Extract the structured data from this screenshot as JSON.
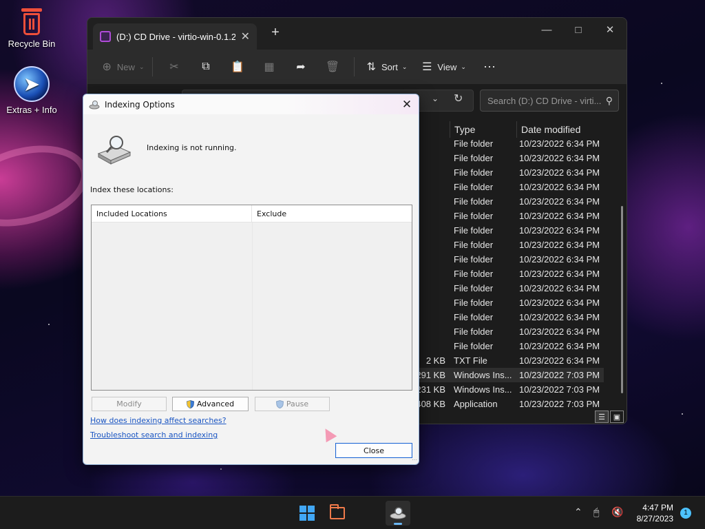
{
  "desktop": {
    "icons": [
      {
        "label": "Recycle Bin",
        "icon": "recycle-bin-icon"
      },
      {
        "label": "Extras + Info",
        "icon": "extras-info-icon"
      }
    ]
  },
  "explorer": {
    "tab_title": "(D:) CD Drive - virtio-win-0.1.2",
    "toolbar": {
      "new_label": "New",
      "sort_label": "Sort",
      "view_label": "View"
    },
    "search_placeholder": "Search (D:) CD Drive - virti...",
    "columns": {
      "type": "Type",
      "date": "Date modified"
    },
    "rows": [
      {
        "size": "",
        "type": "File folder",
        "date": "10/23/2022 6:34 PM"
      },
      {
        "size": "",
        "type": "File folder",
        "date": "10/23/2022 6:34 PM"
      },
      {
        "size": "",
        "type": "File folder",
        "date": "10/23/2022 6:34 PM"
      },
      {
        "size": "",
        "type": "File folder",
        "date": "10/23/2022 6:34 PM"
      },
      {
        "size": "",
        "type": "File folder",
        "date": "10/23/2022 6:34 PM"
      },
      {
        "size": "",
        "type": "File folder",
        "date": "10/23/2022 6:34 PM"
      },
      {
        "size": "",
        "type": "File folder",
        "date": "10/23/2022 6:34 PM"
      },
      {
        "size": "",
        "type": "File folder",
        "date": "10/23/2022 6:34 PM"
      },
      {
        "size": "",
        "type": "File folder",
        "date": "10/23/2022 6:34 PM"
      },
      {
        "size": "",
        "type": "File folder",
        "date": "10/23/2022 6:34 PM"
      },
      {
        "size": "",
        "type": "File folder",
        "date": "10/23/2022 6:34 PM"
      },
      {
        "size": "",
        "type": "File folder",
        "date": "10/23/2022 6:34 PM"
      },
      {
        "size": "",
        "type": "File folder",
        "date": "10/23/2022 6:34 PM"
      },
      {
        "size": "",
        "type": "File folder",
        "date": "10/23/2022 6:34 PM"
      },
      {
        "size": "",
        "type": "File folder",
        "date": "10/23/2022 6:34 PM"
      },
      {
        "size": "2 KB",
        "type": "TXT File",
        "date": "10/23/2022 6:34 PM"
      },
      {
        "size": "291 KB",
        "type": "Windows Ins...",
        "date": "10/23/2022 7:03 PM"
      },
      {
        "size": "231 KB",
        "type": "Windows Ins...",
        "date": "10/23/2022 7:03 PM"
      },
      {
        "size": "408 KB",
        "type": "Application",
        "date": "10/23/2022 7:03 PM"
      }
    ]
  },
  "dialog": {
    "title": "Indexing Options",
    "status": "Indexing is not running.",
    "index_label": "Index these locations:",
    "table_headers": {
      "included": "Included Locations",
      "exclude": "Exclude"
    },
    "buttons": {
      "modify": "Modify",
      "advanced": "Advanced",
      "pause": "Pause",
      "close": "Close"
    },
    "links": {
      "how": "How does indexing affect searches?",
      "troubleshoot": "Troubleshoot search and indexing"
    }
  },
  "taskbar": {
    "time": "4:47 PM",
    "date": "8/27/2023",
    "notification_count": "1"
  },
  "colors": {
    "accent": "#41a7f5",
    "link": "#1a55c2",
    "recycle": "#ef4f3a"
  }
}
